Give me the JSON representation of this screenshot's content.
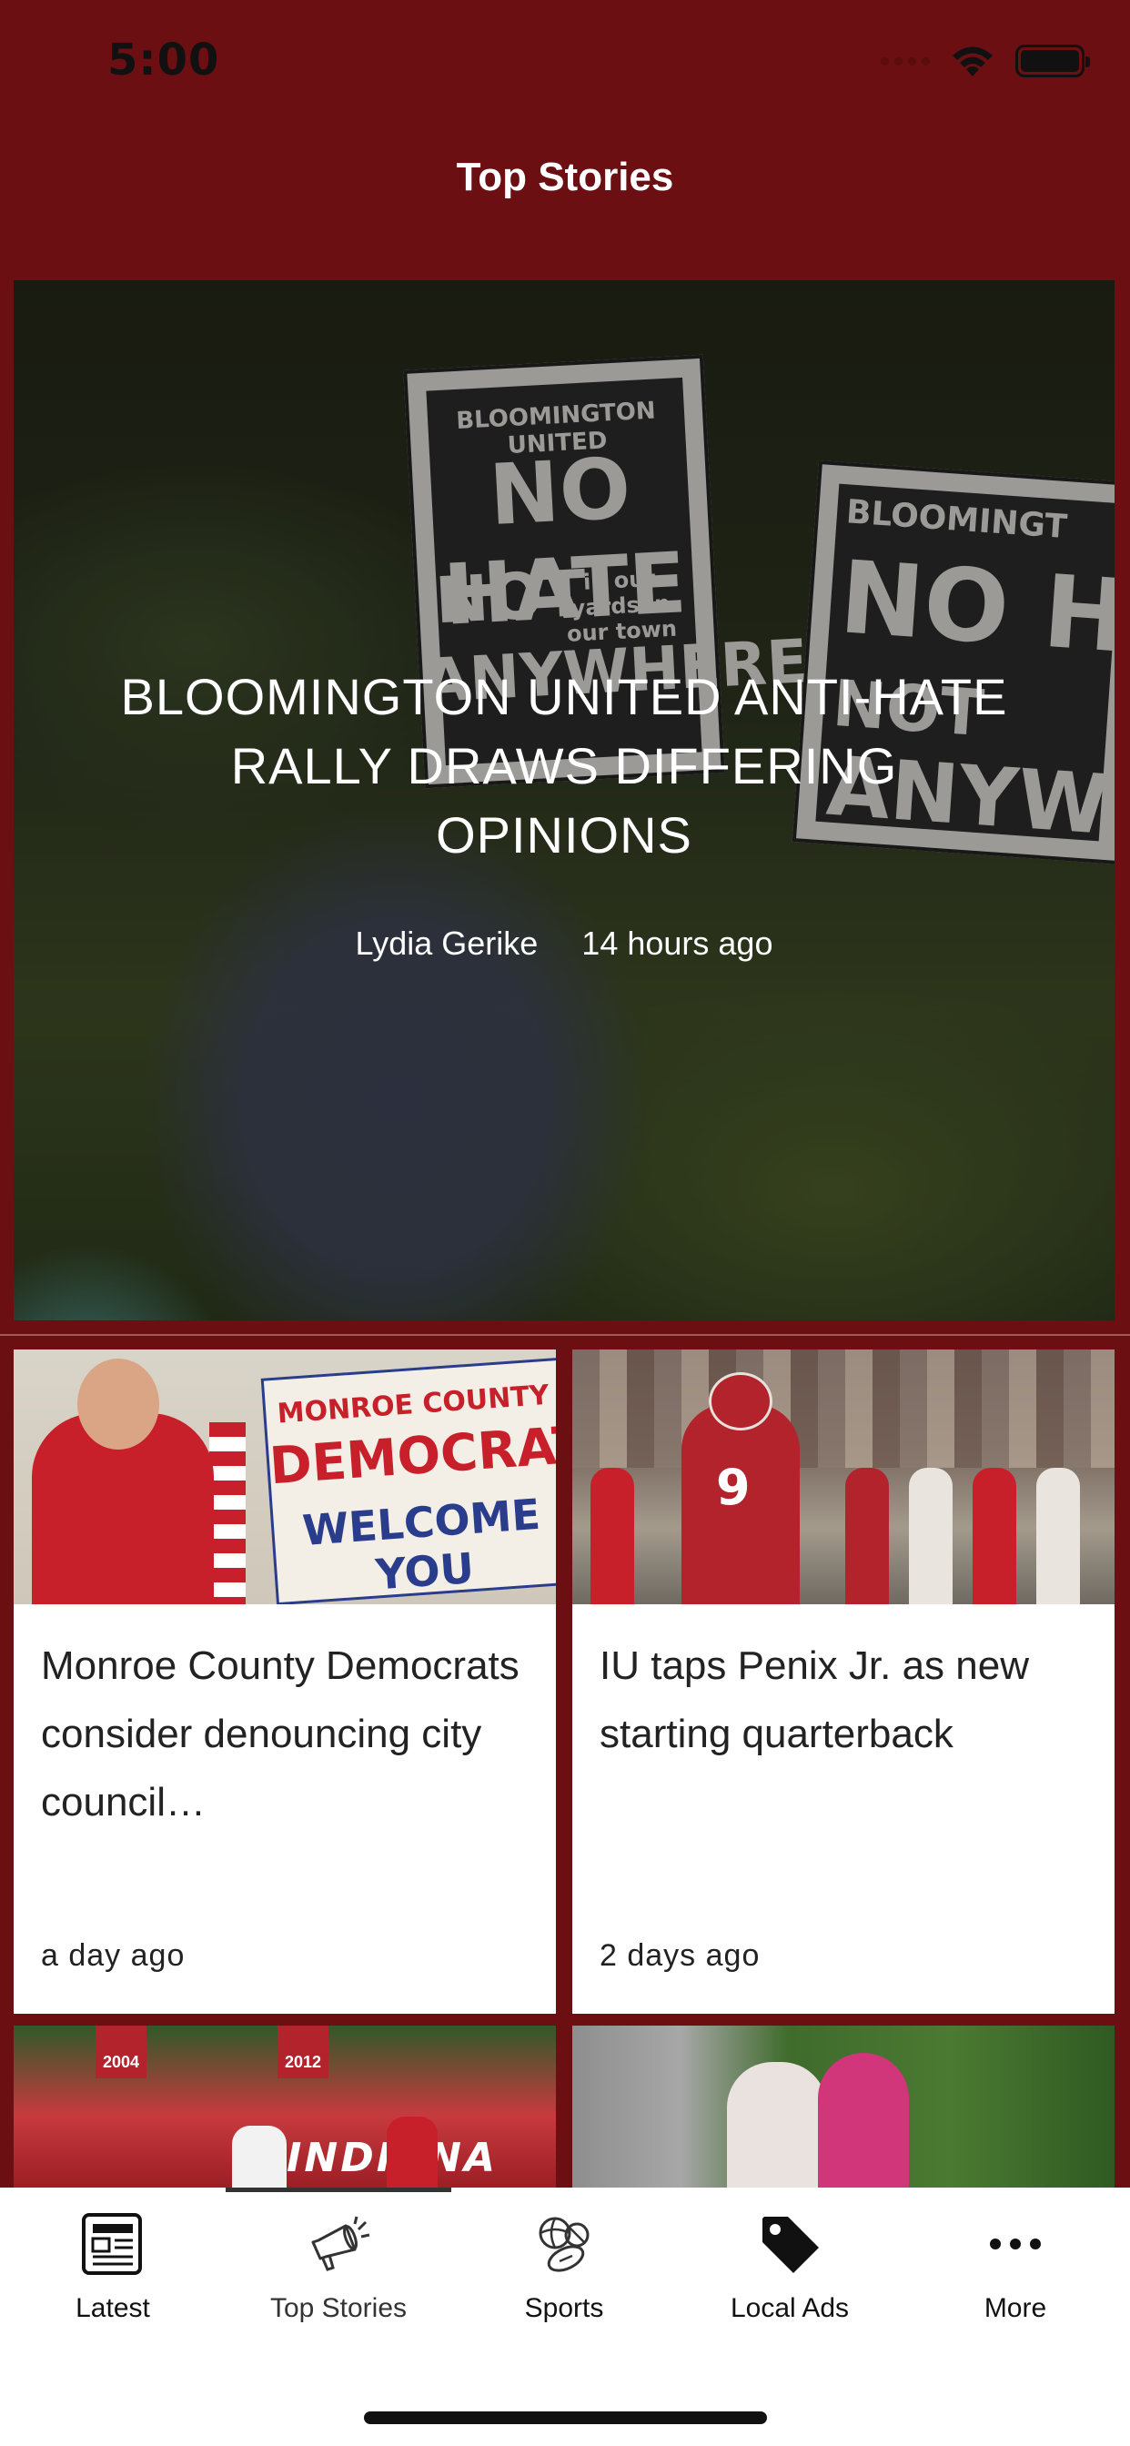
{
  "status_bar": {
    "time": "5:00"
  },
  "header": {
    "title": "Top Stories"
  },
  "hero": {
    "headline": "BLOOMINGTON UNITED ANTI-HATE RALLY DRAWS DIFFERING OPINIONS",
    "author": "Lydia Gerike",
    "time": "14 hours ago",
    "sign_a": {
      "line1": "BLOOMINGTON UNITED",
      "line2": "NO HATE",
      "line3": "NOT",
      "line4": "in our yards in our town",
      "line5": "ANYWHERE"
    },
    "sign_b": {
      "line1": "BLOOMINGT",
      "line2": "NO H",
      "line3": "NOT",
      "line4": "ANYW"
    }
  },
  "cards": [
    {
      "title": "Monroe County Democrats consider denouncing city council…",
      "time": "a day ago",
      "image_text": {
        "line1": "MONROE COUNTY",
        "line2": "DEMOCRATS",
        "line3": "WELCOME YOU"
      }
    },
    {
      "title": "IU taps Penix Jr. as new starting quarterback",
      "time": "2 days ago",
      "image_text": {
        "jersey": "9"
      }
    }
  ],
  "thumbs": [
    {
      "signs": [
        "2004",
        "2012"
      ],
      "banner": "INDIANA"
    },
    {}
  ],
  "tabbar": {
    "active": "Top Stories",
    "tabs": [
      {
        "label": "Latest",
        "icon": "newspaper-icon"
      },
      {
        "label": "Top Stories",
        "icon": "megaphone-icon"
      },
      {
        "label": "Sports",
        "icon": "sports-balls-icon"
      },
      {
        "label": "Local Ads",
        "icon": "tag-icon"
      },
      {
        "label": "More",
        "icon": "more-icon"
      }
    ]
  },
  "colors": {
    "brand": "#6b0f12",
    "text": "#222222"
  }
}
